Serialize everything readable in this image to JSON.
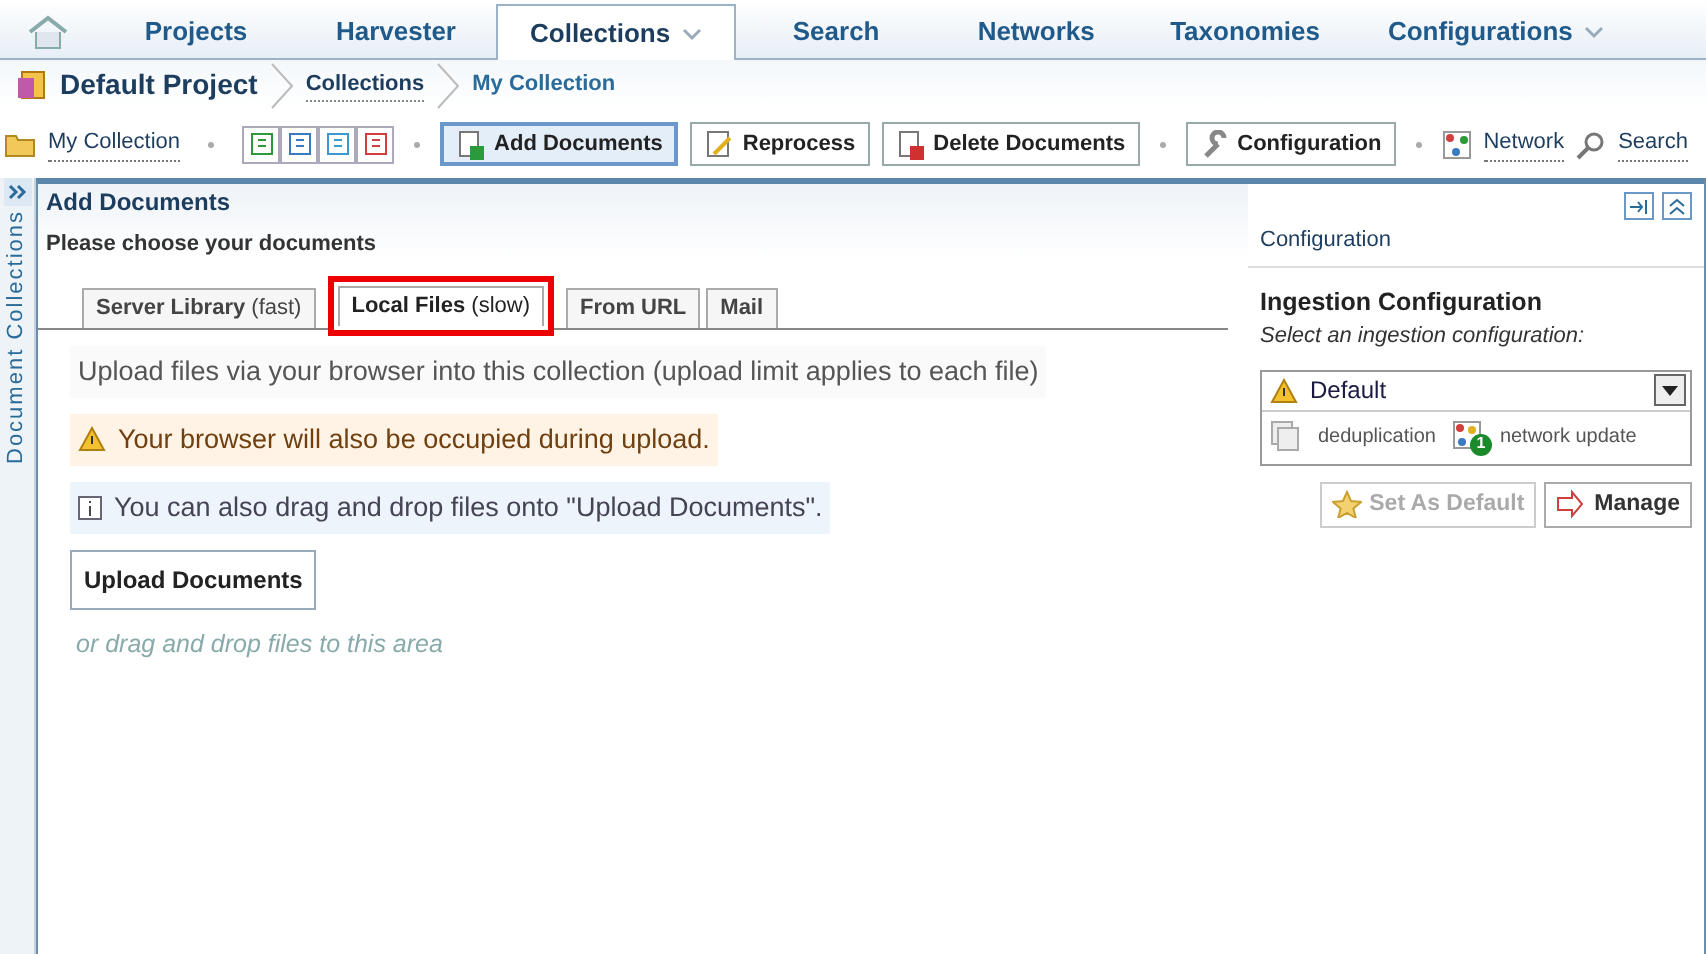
{
  "main_tabs": [
    {
      "label": "Projects",
      "selected": false,
      "dropdown": false
    },
    {
      "label": "Harvester",
      "selected": false,
      "dropdown": false
    },
    {
      "label": "Collections",
      "selected": true,
      "dropdown": true
    },
    {
      "label": "Search",
      "selected": false,
      "dropdown": false
    },
    {
      "label": "Networks",
      "selected": false,
      "dropdown": false
    },
    {
      "label": "Taxonomies",
      "selected": false,
      "dropdown": false
    },
    {
      "label": "Configurations",
      "selected": false,
      "dropdown": true
    }
  ],
  "breadcrumb": {
    "project": "Default Project",
    "items": [
      "Collections",
      "My Collection"
    ]
  },
  "toolbar": {
    "collection": "My Collection",
    "buttons": [
      {
        "label": "Add Documents",
        "selected": true
      },
      {
        "label": "Reprocess",
        "selected": false
      },
      {
        "label": "Delete Documents",
        "selected": false
      },
      {
        "label": "Configuration",
        "selected": false
      }
    ],
    "links": [
      "Network",
      "Search"
    ]
  },
  "side_strip": {
    "label": "Document Collections"
  },
  "panel": {
    "title": "Add Documents",
    "subtitle": "Please choose your documents",
    "tabs": [
      {
        "label": "Server Library",
        "note": "(fast)",
        "selected": false,
        "highlighted": false
      },
      {
        "label": "Local Files",
        "note": "(slow)",
        "selected": true,
        "highlighted": true
      },
      {
        "label": "From URL",
        "selected": false,
        "highlighted": false
      },
      {
        "label": "Mail",
        "selected": false,
        "highlighted": false
      }
    ],
    "messages": [
      {
        "kind": "plain",
        "text": "Upload files via your browser into this collection (upload limit applies to each file)"
      },
      {
        "kind": "warning",
        "text": "Your browser will also be occupied during upload."
      },
      {
        "kind": "info",
        "text": "You can also drag and drop files onto \"Upload Documents\"."
      }
    ],
    "upload_button": "Upload Documents",
    "drop_hint": "or drag and drop files to this area"
  },
  "config": {
    "header": "Configuration",
    "title": "Ingestion Configuration",
    "hint": "Select an ingestion configuration:",
    "selected": "Default",
    "features": [
      {
        "label": "deduplication"
      },
      {
        "label": "network update",
        "badge": "1"
      }
    ],
    "buttons": [
      {
        "label": "Set As Default",
        "disabled": true
      },
      {
        "label": "Manage",
        "disabled": false
      }
    ]
  }
}
